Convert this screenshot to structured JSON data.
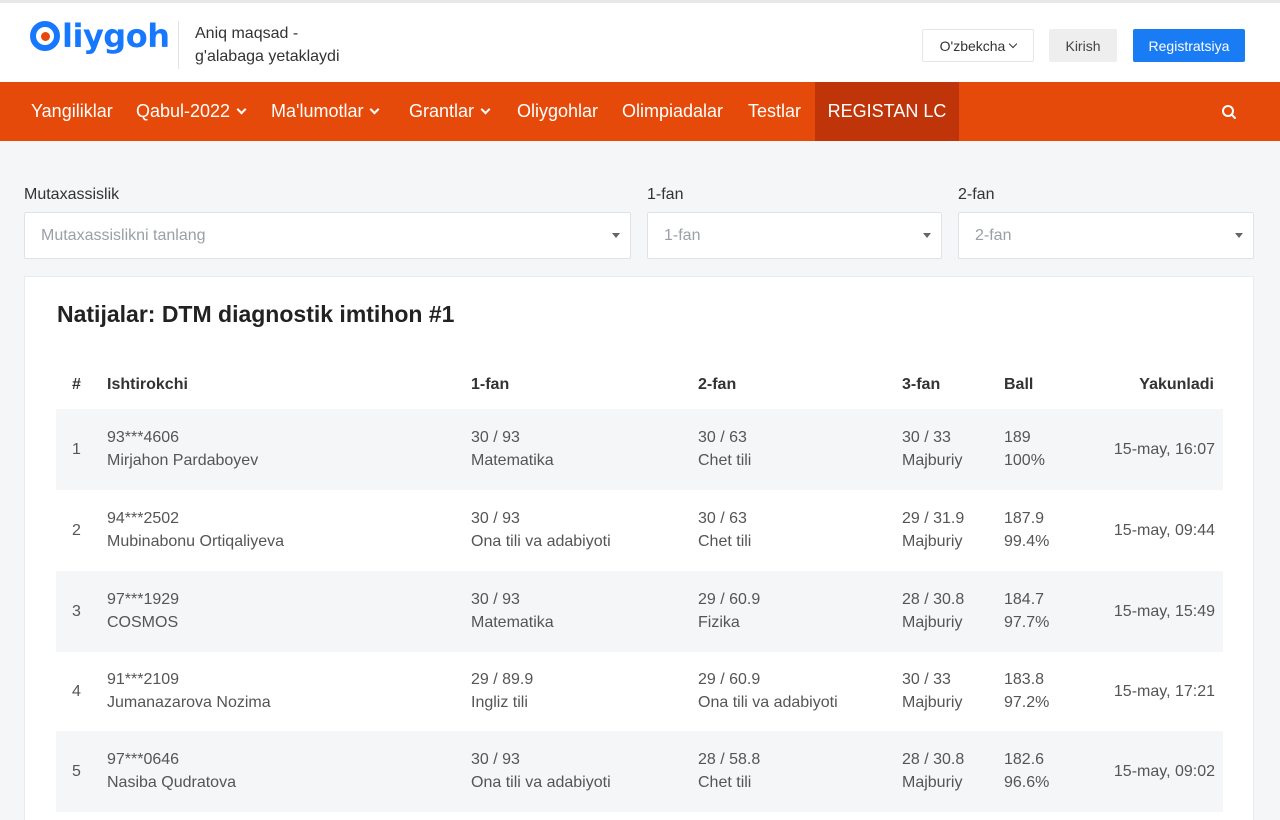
{
  "brand": {
    "logo_text": "liygoh",
    "tagline_line1": "Aniq maqsad -",
    "tagline_line2": "g'alabaga yetaklaydi",
    "primary_color": "#1677ff",
    "accent_color": "#e64a0a"
  },
  "header": {
    "language": "O'zbekcha",
    "login_label": "Kirish",
    "register_label": "Registratsiya"
  },
  "nav": {
    "items": [
      {
        "label": "Yangiliklar",
        "dropdown": false
      },
      {
        "label": "Qabul-2022",
        "dropdown": true
      },
      {
        "label": "Ma'lumotlar",
        "dropdown": true
      },
      {
        "label": "Grantlar",
        "dropdown": true
      },
      {
        "label": "Oliygohlar",
        "dropdown": false
      },
      {
        "label": "Olimpiadalar",
        "dropdown": false
      },
      {
        "label": "Testlar",
        "dropdown": false
      },
      {
        "label": "REGISTAN LC",
        "dropdown": false,
        "active": true
      }
    ],
    "search_icon": "search-icon"
  },
  "filters": {
    "specialty": {
      "label": "Mutaxassislik",
      "placeholder": "Mutaxassislikni tanlang"
    },
    "subject1": {
      "label": "1-fan",
      "placeholder": "1-fan"
    },
    "subject2": {
      "label": "2-fan",
      "placeholder": "2-fan"
    }
  },
  "results": {
    "title": "Natijalar: DTM diagnostik imtihon #1",
    "columns": {
      "num": "#",
      "participant": "Ishtirokchi",
      "subject1": "1-fan",
      "subject2": "2-fan",
      "subject3": "3-fan",
      "ball": "Ball",
      "finished": "Yakunladi"
    },
    "rows": [
      {
        "num": "1",
        "phone": "93***4606",
        "name": "Mirjahon Pardaboyev",
        "f1_score": "30 / 93",
        "f1_name": "Matematika",
        "f2_score": "30 / 63",
        "f2_name": "Chet tili",
        "f3_score": "30 / 33",
        "f3_name": "Majburiy",
        "ball": "189",
        "percent": "100%",
        "finished": "15-may, 16:07"
      },
      {
        "num": "2",
        "phone": "94***2502",
        "name": "Mubinabonu Ortiqaliyeva",
        "f1_score": "30 / 93",
        "f1_name": "Ona tili va adabiyoti",
        "f2_score": "30 / 63",
        "f2_name": "Chet tili",
        "f3_score": "29 / 31.9",
        "f3_name": "Majburiy",
        "ball": "187.9",
        "percent": "99.4%",
        "finished": "15-may, 09:44"
      },
      {
        "num": "3",
        "phone": "97***1929",
        "name": "COSMOS",
        "f1_score": "30 / 93",
        "f1_name": "Matematika",
        "f2_score": "29 / 60.9",
        "f2_name": "Fizika",
        "f3_score": "28 / 30.8",
        "f3_name": "Majburiy",
        "ball": "184.7",
        "percent": "97.7%",
        "finished": "15-may, 15:49"
      },
      {
        "num": "4",
        "phone": "91***2109",
        "name": "Jumanazarova Nozima",
        "f1_score": "29 / 89.9",
        "f1_name": "Ingliz tili",
        "f2_score": "29 / 60.9",
        "f2_name": "Ona tili va adabiyoti",
        "f3_score": "30 / 33",
        "f3_name": "Majburiy",
        "ball": "183.8",
        "percent": "97.2%",
        "finished": "15-may, 17:21"
      },
      {
        "num": "5",
        "phone": "97***0646",
        "name": "Nasiba Qudratova",
        "f1_score": "30 / 93",
        "f1_name": "Ona tili va adabiyoti",
        "f2_score": "28 / 58.8",
        "f2_name": "Chet tili",
        "f3_score": "28 / 30.8",
        "f3_name": "Majburiy",
        "ball": "182.6",
        "percent": "96.6%",
        "finished": "15-may, 09:02"
      }
    ]
  }
}
